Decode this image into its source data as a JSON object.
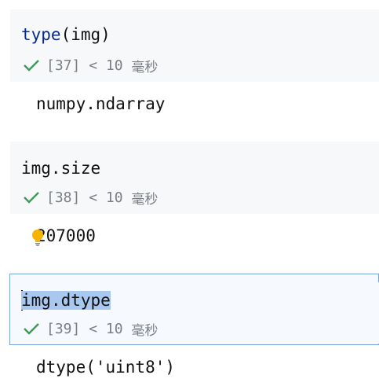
{
  "cells": [
    {
      "code_kw": "type",
      "code_rest": "(img)",
      "exec_count": "[37]",
      "time": "< 10 ",
      "unit": "毫秒",
      "output": "numpy.ndarray"
    },
    {
      "code": "img.size",
      "exec_count": "[38]",
      "time": "< 10 ",
      "unit": "毫秒",
      "output": "207000"
    },
    {
      "code_first_char": "i",
      "code_rest": "mg.dtype",
      "exec_count": "[39]",
      "time": "< 10 ",
      "unit": "毫秒",
      "output": "dtype('uint8')"
    }
  ],
  "icons": {
    "success": "check-icon",
    "hint": "lightbulb-icon"
  },
  "colors": {
    "success_green": "#3f9a58",
    "selection": "#a8c8f0",
    "active_border": "#7aa2db",
    "keyword": "#0a2a8a",
    "bulb": "#f5b400"
  }
}
